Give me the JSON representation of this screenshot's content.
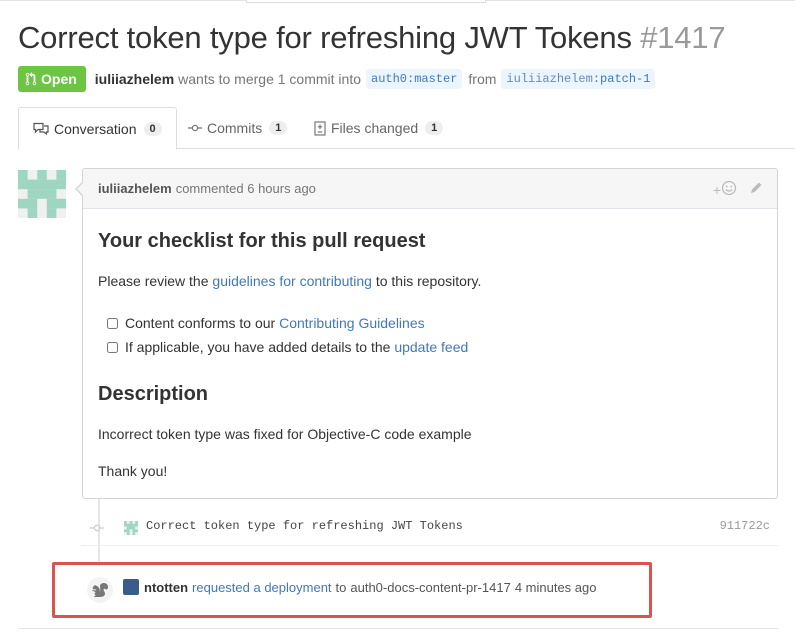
{
  "pr": {
    "title": "Correct token type for refreshing JWT Tokens",
    "number": "#1417",
    "state": "Open",
    "author": "iuliiazhelem",
    "merge_text": "wants to merge 1 commit into",
    "base_branch": "auth0:master",
    "from_text": "from",
    "head_branch_user": "iuliiazhelem",
    "head_branch_name": ":patch-1"
  },
  "tabs": [
    {
      "label": "Conversation",
      "count": "0",
      "icon": "comment-discussion-icon"
    },
    {
      "label": "Commits",
      "count": "1",
      "icon": "git-commit-icon"
    },
    {
      "label": "Files changed",
      "count": "1",
      "icon": "diff-icon"
    }
  ],
  "comment": {
    "author": "iuliiazhelem",
    "time_text": "commented 6 hours ago",
    "heading": "Your checklist for this pull request",
    "review_pre": "Please review the",
    "review_link": "guidelines for contributing",
    "review_post": "to this repository.",
    "checks": [
      {
        "pre": "Content conforms to our",
        "link": "Contributing Guidelines",
        "checked": false
      },
      {
        "pre": "If applicable, you have added details to the",
        "link": "update feed",
        "checked": false
      }
    ],
    "description_heading": "Description",
    "description_text": "Incorrect token type was fixed for Objective-C code example",
    "thanks": "Thank you!",
    "add_reaction": "+",
    "reaction_icon": "smiley-icon",
    "edit_icon": "pencil-icon"
  },
  "commit": {
    "message": "Correct token type for refreshing JWT Tokens",
    "sha": "911722c"
  },
  "deployment": {
    "user": "ntotten",
    "action": "requested a deployment",
    "to_text": "to",
    "environment": "auth0-docs-content-pr-1417",
    "time": "4 minutes ago",
    "icon": "squirrel-icon"
  },
  "colors": {
    "open_green": "#6cc644",
    "link_blue": "#4078c0",
    "highlight_red": "#d9534f"
  }
}
